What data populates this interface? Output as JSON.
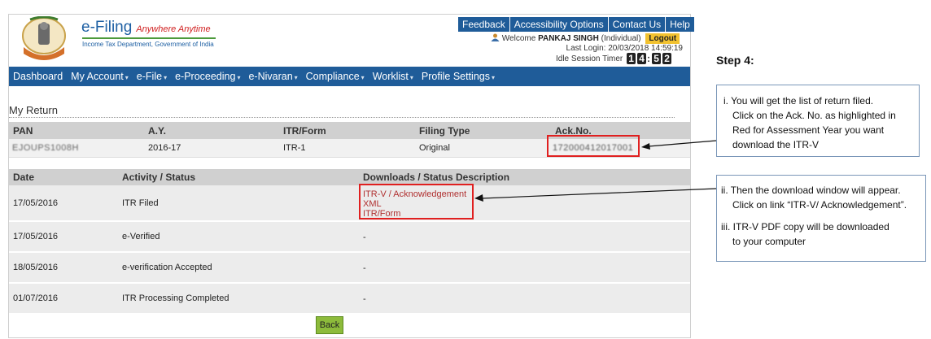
{
  "brand": {
    "title": "e-Filing",
    "tagline": "Anywhere Anytime",
    "subtitle": "Income Tax Department, Government of India"
  },
  "top_links": [
    "Feedback",
    "Accessibility Options",
    "Contact Us",
    "Help"
  ],
  "user": {
    "welcome_prefix": "Welcome",
    "name": "PANKAJ SINGH",
    "role": "(Individual)",
    "logout_label": "Logout",
    "last_login_label": "Last Login:",
    "last_login_value": "20/03/2018 14:59:19",
    "idle_label": "Idle Session Timer",
    "idle_digits": [
      "1",
      "4",
      "5",
      "2"
    ]
  },
  "nav": [
    {
      "label": "Dashboard",
      "dropdown": false
    },
    {
      "label": "My Account",
      "dropdown": true
    },
    {
      "label": "e-File",
      "dropdown": true
    },
    {
      "label": "e-Proceeding",
      "dropdown": true
    },
    {
      "label": "e-Nivaran",
      "dropdown": true
    },
    {
      "label": "Compliance",
      "dropdown": true
    },
    {
      "label": "Worklist",
      "dropdown": true
    },
    {
      "label": "Profile Settings",
      "dropdown": true
    }
  ],
  "page_title": "My Return",
  "return_table": {
    "headers": [
      "PAN",
      "A.Y.",
      "ITR/Form",
      "Filing Type",
      "Ack.No."
    ],
    "row": {
      "pan": "EJOUPS1008H",
      "ay": "2016-17",
      "itr_form": "ITR-1",
      "filing_type": "Original",
      "ack_no": "172000412017001"
    }
  },
  "activity_table": {
    "headers": [
      "Date",
      "Activity / Status",
      "Downloads / Status Description"
    ],
    "rows": [
      {
        "date": "17/05/2016",
        "activity": "ITR Filed",
        "links": [
          "ITR-V / Acknowledgement",
          "XML",
          "ITR/Form"
        ]
      },
      {
        "date": "17/05/2016",
        "activity": "e-Verified",
        "desc": "-"
      },
      {
        "date": "18/05/2016",
        "activity": "e-verification Accepted",
        "desc": "-"
      },
      {
        "date": "01/07/2016",
        "activity": "ITR Processing Completed",
        "desc": "-"
      }
    ]
  },
  "back_label": "Back",
  "instructions": {
    "step_title": "Step 4:",
    "callout1": [
      "i. You will get the list of return filed.",
      "Click on the Ack. No. as highlighted in",
      "Red for Assessment Year you want",
      "download the ITR-V"
    ],
    "callout2": [
      "ii. Then the download window will appear.",
      "Click on link “ITR-V/ Acknowledgement”.",
      "",
      "iii. ITR-V PDF copy will be downloaded",
      "to your computer"
    ]
  },
  "colors": {
    "nav_blue": "#1f5c99",
    "highlight_red": "#e02020",
    "back_green": "#8dbb3b",
    "link_red": "#b03030",
    "logout_yellow": "#f2c230"
  }
}
